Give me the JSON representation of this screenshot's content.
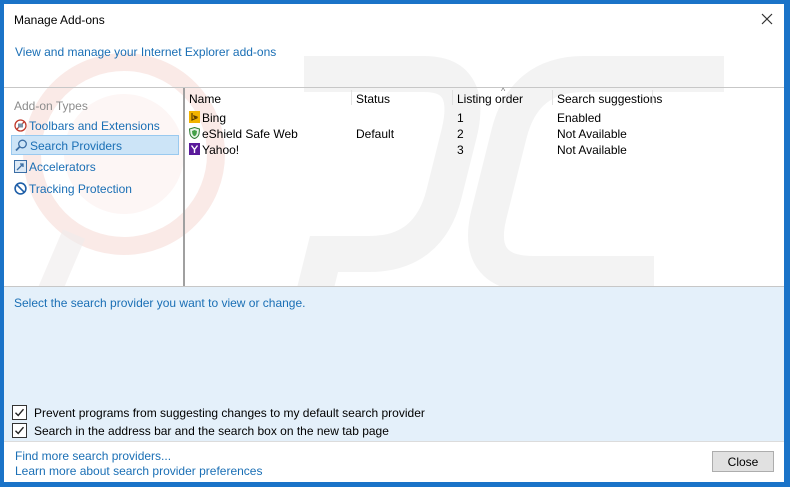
{
  "window": {
    "title": "Manage Add-ons",
    "header_link": "View and manage your Internet Explorer add-ons"
  },
  "sidebar": {
    "heading": "Add-on Types",
    "items": [
      {
        "label": "Toolbars and Extensions",
        "icon": "toolbars-icon"
      },
      {
        "label": "Search Providers",
        "icon": "search-icon",
        "selected": true
      },
      {
        "label": "Accelerators",
        "icon": "accelerators-icon"
      },
      {
        "label": "Tracking Protection",
        "icon": "tracking-protection-icon"
      }
    ]
  },
  "list": {
    "columns": [
      "Name",
      "Status",
      "Listing order",
      "Search suggestions"
    ],
    "rows": [
      {
        "name": "Bing",
        "status": "",
        "order": "1",
        "suggestions": "Enabled",
        "icon": "bing-icon"
      },
      {
        "name": "eShield Safe Web",
        "status": "Default",
        "order": "2",
        "suggestions": "Not Available",
        "icon": "eshield-icon"
      },
      {
        "name": "Yahoo!",
        "status": "",
        "order": "3",
        "suggestions": "Not Available",
        "icon": "yahoo-icon"
      }
    ]
  },
  "details": {
    "prompt": "Select the search provider you want to view or change.",
    "checkboxes": [
      {
        "label": "Prevent programs from suggesting changes to my default search provider",
        "checked": true
      },
      {
        "label": "Search in the address bar and the search box on the new tab page",
        "checked": true
      }
    ]
  },
  "footer": {
    "link_find": "Find more search providers...",
    "link_learn": "Learn more about search provider preferences",
    "close_label": "Close"
  },
  "colors": {
    "frame": "#1a73c8",
    "link": "#1a6fb5",
    "selection": "#cce4f7",
    "details_bg": "#e4f0fa"
  }
}
